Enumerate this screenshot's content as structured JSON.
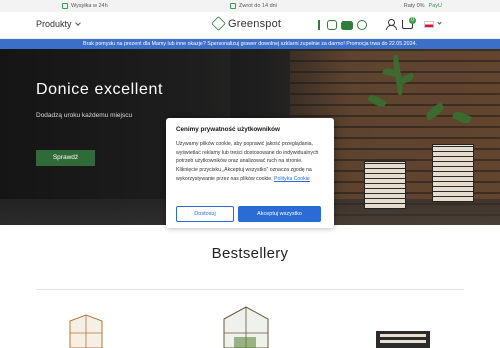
{
  "topbar": {
    "shipping": "Wysyłka w 24h",
    "returns": "Zwrot do 14 dni",
    "rates_label": "Raty 0%",
    "rates_provider": "PayU"
  },
  "header": {
    "menu_label": "Produkty",
    "logo_text": "Greenspot",
    "cart_count": "0",
    "language": "pl"
  },
  "promo": {
    "text": "Brak pomysłu na prezent dla Mamy lub inne okazje? Spersonalizuj grawer dowolnej szklarni zupełnie za darmo! Promocja trwa do 22.05.2024."
  },
  "hero": {
    "title": "Donice excellent",
    "subtitle": "Dodadzą uroku każdemu miejscu",
    "button": "Sprawdź"
  },
  "cookie_modal": {
    "title": "Cenimy prywatność użytkowników",
    "body": "Używamy plików cookie, aby poprawić jakość przeglądania, wyświetlać reklamy lub treści dostosowane do indywidualnych potrzeb użytkowników oraz analizować ruch na stronie. Kliknięcie przycisku „Akceptuj wszystko” oznacza zgodę na wykorzystywanie przez nas plików cookie.",
    "policy_link": "Polityka Cookie",
    "configure_button": "Dostosuj",
    "accept_button": "Akceptuj wszystko"
  },
  "bestsellers": {
    "title": "Bestsellery"
  },
  "colors": {
    "brand_green": "#2f7d3a",
    "promo_blue": "#3b6fc9",
    "accept_blue": "#2b6bd6"
  },
  "icons": [
    "truck-icon",
    "return-icon",
    "facebook-icon",
    "instagram-icon",
    "youtube-icon",
    "pinterest-icon",
    "user-icon",
    "cart-icon",
    "flag-pl-icon"
  ]
}
